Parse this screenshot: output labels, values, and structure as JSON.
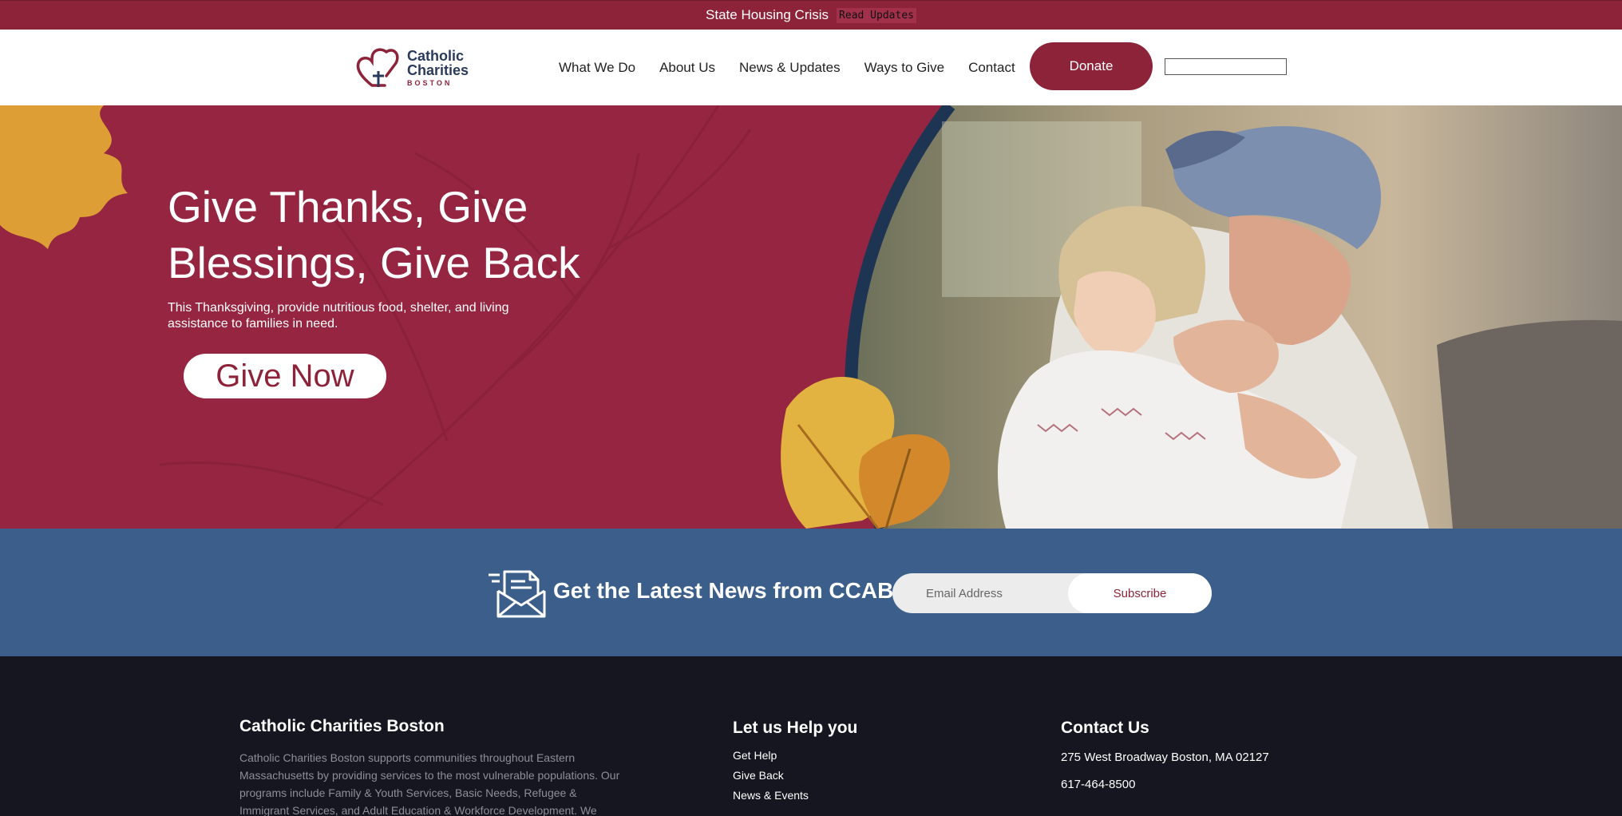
{
  "alert": {
    "text": "State Housing Crisis",
    "link": "Read Updates"
  },
  "header": {
    "logo": {
      "line1": "Catholic",
      "line2": "Charities",
      "line3": "BOSTON"
    },
    "nav": [
      "What We Do",
      "About Us",
      "News & Updates",
      "Ways to Give",
      "Contact"
    ],
    "donate_label": "Donate",
    "search_value": ""
  },
  "hero": {
    "title": "Give Thanks, Give Blessings, Give Back",
    "subtitle": "This Thanksgiving, provide nutritious food, shelter, and living assistance to families in need.",
    "cta_label": "Give Now"
  },
  "newsletter": {
    "title": "Get the Latest News from CCAB",
    "email_placeholder": "Email Address",
    "subscribe_label": "Subscribe"
  },
  "footer": {
    "about": {
      "heading": "Catholic Charities Boston",
      "text": "Catholic Charities Boston supports communities throughout Eastern Massachusetts by providing services to the most vulnerable populations. Our programs include Family & Youth Services, Basic Needs, Refugee & Immigrant Services, and Adult Education & Workforce Development. We"
    },
    "help": {
      "heading": "Let us Help you",
      "links": [
        "Get Help",
        "Give Back",
        "News & Events"
      ]
    },
    "contact": {
      "heading": "Contact Us",
      "address": "275 West Broadway Boston, MA 02127",
      "phone": "617-464-8500"
    }
  },
  "colors": {
    "brand_red": "#8c2339",
    "hero_red": "#952540",
    "news_blue": "#3b5f8a",
    "footer_dark": "#15161f",
    "navy": "#2a3a5c"
  }
}
